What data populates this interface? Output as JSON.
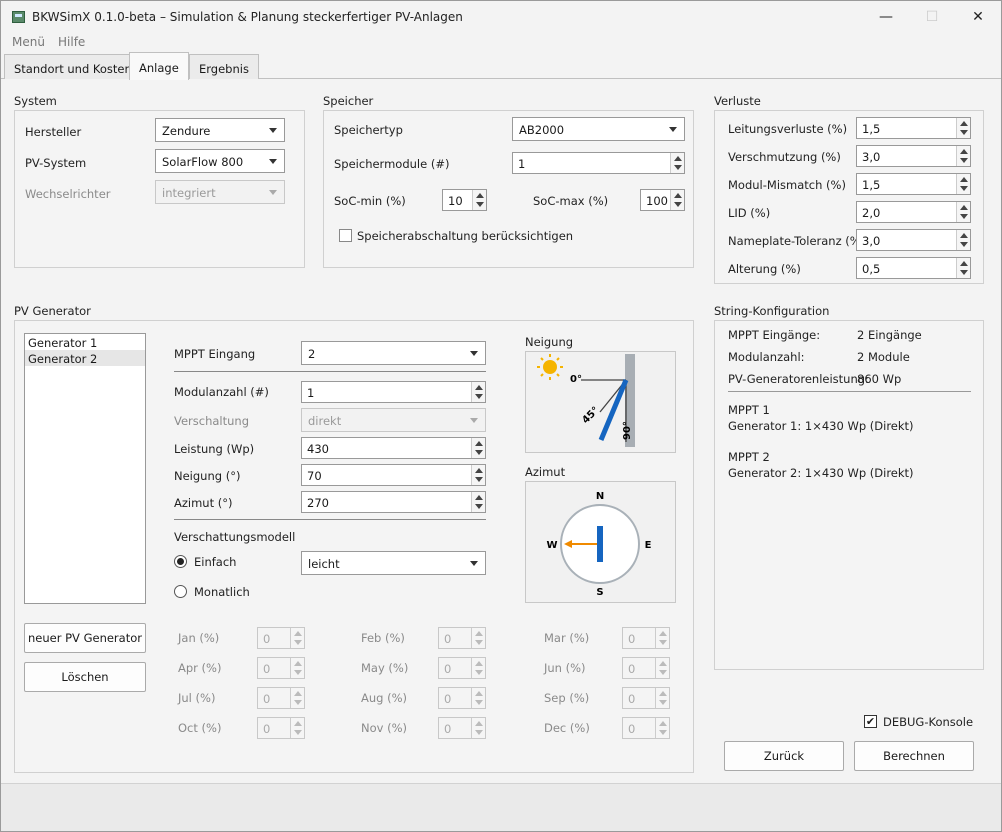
{
  "window": {
    "title": "BKWSimX 0.1.0-beta – Simulation & Planung steckerfertiger PV-Anlagen",
    "minimize": "—",
    "maximize": "☐",
    "close": "✕"
  },
  "menu": {
    "items": [
      "Menü",
      "Hilfe"
    ]
  },
  "tabs": [
    {
      "label": "Standort und Kosten",
      "active": false
    },
    {
      "label": "Anlage",
      "active": true
    },
    {
      "label": "Ergebnis",
      "active": false
    }
  ],
  "system": {
    "title": "System",
    "hersteller_label": "Hersteller",
    "hersteller_value": "Zendure",
    "pvsystem_label": "PV-System",
    "pvsystem_value": "SolarFlow 800",
    "wr_label": "Wechselrichter",
    "wr_value": "integriert"
  },
  "speicher": {
    "title": "Speicher",
    "typ_label": "Speichertyp",
    "typ_value": "AB2000",
    "module_label": "Speichermodule (#)",
    "module_value": "1",
    "socmin_label": "SoC-min (%)",
    "socmin_value": "10",
    "socmax_label": "SoC-max (%)",
    "socmax_value": "100",
    "abschalt_label": "Speicherabschaltung berücksichtigen",
    "abschalt_checked": false
  },
  "verluste": {
    "title": "Verluste",
    "rows": [
      {
        "label": "Leitungsverluste (%)",
        "value": "1,5"
      },
      {
        "label": "Verschmutzung (%)",
        "value": "3,0"
      },
      {
        "label": "Modul-Mismatch (%)",
        "value": "1,5"
      },
      {
        "label": "LID (%)",
        "value": "2,0"
      },
      {
        "label": "Nameplate-Toleranz (%)",
        "value": "3,0"
      },
      {
        "label": "Alterung (%)",
        "value": "0,5"
      }
    ]
  },
  "pvgen": {
    "title": "PV Generator",
    "list": [
      "Generator 1",
      "Generator 2"
    ],
    "selected_index": 1,
    "mppt_label": "MPPT Eingang",
    "mppt_value": "2",
    "modulanzahl_label": "Modulanzahl (#)",
    "modulanzahl_value": "1",
    "verschaltung_label": "Verschaltung",
    "verschaltung_value": "direkt",
    "leistung_label": "Leistung (Wp)",
    "leistung_value": "430",
    "neigung_label": "Neigung (°)",
    "neigung_value": "70",
    "azimut_label": "Azimut (°)",
    "azimut_value": "270",
    "schatten_label": "Verschattungsmodell",
    "einfach_label": "Einfach",
    "monatlich_label": "Monatlich",
    "schatten_value": "leicht",
    "new_button": "neuer PV Generator",
    "delete_button": "Löschen",
    "months": [
      {
        "label": "Jan (%)",
        "value": "0"
      },
      {
        "label": "Feb (%)",
        "value": "0"
      },
      {
        "label": "Mar (%)",
        "value": "0"
      },
      {
        "label": "Apr (%)",
        "value": "0"
      },
      {
        "label": "May (%)",
        "value": "0"
      },
      {
        "label": "Jun (%)",
        "value": "0"
      },
      {
        "label": "Jul (%)",
        "value": "0"
      },
      {
        "label": "Aug (%)",
        "value": "0"
      },
      {
        "label": "Sep (%)",
        "value": "0"
      },
      {
        "label": "Oct (%)",
        "value": "0"
      },
      {
        "label": "Nov (%)",
        "value": "0"
      },
      {
        "label": "Dec (%)",
        "value": "0"
      }
    ]
  },
  "neigung_vis": {
    "title": "Neigung",
    "tick0": "0°",
    "tick45": "45°",
    "tick90": "90°",
    "tilt_deg": 70
  },
  "azimut_vis": {
    "title": "Azimut",
    "n": "N",
    "e": "E",
    "s": "S",
    "w": "W",
    "azimuth_deg": 270
  },
  "string": {
    "title": "String-Konfiguration",
    "mppt_count_label": "MPPT Eingänge:",
    "mppt_count_value": "2 Eingänge",
    "module_count_label": "Modulanzahl:",
    "module_count_value": "2 Module",
    "power_label": "PV-Generatorenleistung:",
    "power_value": "860 Wp",
    "mppt1_title": "MPPT 1",
    "mppt1_line": "Generator 1: 1×430 Wp (Direkt)",
    "mppt2_title": "MPPT 2",
    "mppt2_line": "Generator 2: 1×430 Wp (Direkt)"
  },
  "footer": {
    "debug_label": "DEBUG-Konsole",
    "debug_checked": true,
    "back_button": "Zurück",
    "calc_button": "Berechnen"
  },
  "colors": {
    "sun": "#f5b400",
    "blue": "#1565c0",
    "arrow": "#f08a00"
  }
}
